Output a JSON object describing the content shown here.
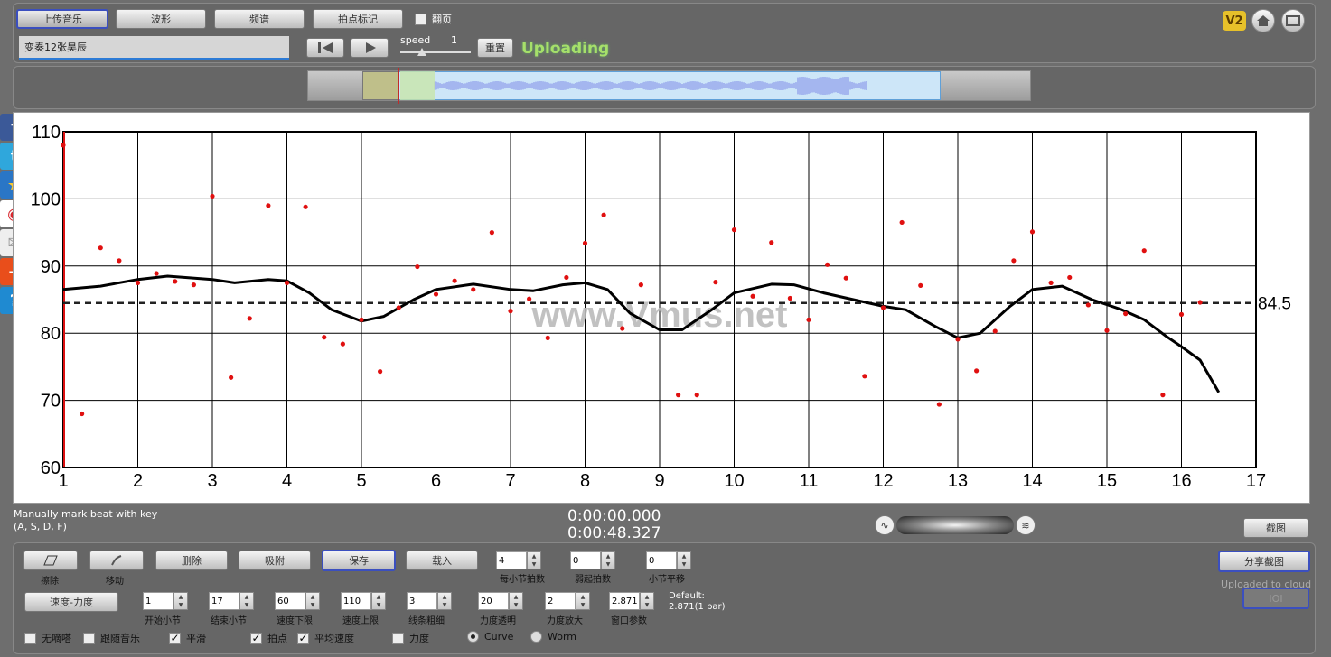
{
  "toolbar": {
    "upload_label": "上传音乐",
    "waveform_label": "波形",
    "spectrum_label": "频谱",
    "beat_mark_label": "拍点标记",
    "page_flip_label": "翻页",
    "page_flip_checked": false
  },
  "track": {
    "name": "变奏12张昊辰"
  },
  "player": {
    "speed_label": "speed",
    "speed_value": "1",
    "reset_label": "重置",
    "status": "Uploading"
  },
  "top_icons": {
    "v2_label": "V2",
    "home_icon": "home-icon",
    "screen_icon": "screen-icon"
  },
  "social": [
    {
      "name": "facebook-icon",
      "glyph": "f",
      "color": "#3b5998"
    },
    {
      "name": "twitter-icon",
      "glyph": "t",
      "color": "#2fa7dc"
    },
    {
      "name": "star-icon",
      "glyph": "★",
      "color": "#2a76c6"
    },
    {
      "name": "weibo-icon",
      "glyph": "◉",
      "color": "#d8272d"
    },
    {
      "name": "mail-icon",
      "glyph": "✉",
      "color": "#e6e6e6"
    },
    {
      "name": "add-icon",
      "glyph": "+",
      "color": "#e94e1b"
    },
    {
      "name": "help-icon",
      "glyph": "?",
      "color": "#1f8ad1"
    }
  ],
  "watermark": "www.Vmus.net",
  "chart_data": {
    "type": "scatter",
    "xlim": [
      1,
      17
    ],
    "ylim": [
      60,
      110
    ],
    "x_ticks": [
      "1",
      "2",
      "3",
      "4",
      "5",
      "6",
      "7",
      "8",
      "9",
      "10",
      "11",
      "12",
      "13",
      "14",
      "15",
      "16",
      "17"
    ],
    "y_ticks": [
      "60",
      "70",
      "80",
      "90",
      "100",
      "110"
    ],
    "grid": true,
    "average": 84.5,
    "average_label": "84.5",
    "points": [
      [
        1.0,
        108
      ],
      [
        1.25,
        68
      ],
      [
        1.5,
        92.7
      ],
      [
        1.75,
        90.8
      ],
      [
        2.0,
        87.5
      ],
      [
        2.25,
        88.9
      ],
      [
        2.5,
        87.7
      ],
      [
        2.75,
        87.2
      ],
      [
        3.0,
        100.4
      ],
      [
        3.25,
        73.4
      ],
      [
        3.5,
        82.2
      ],
      [
        3.75,
        99
      ],
      [
        4.0,
        87.5
      ],
      [
        4.25,
        98.8
      ],
      [
        4.5,
        79.4
      ],
      [
        4.75,
        78.4
      ],
      [
        5.0,
        82
      ],
      [
        5.25,
        74.3
      ],
      [
        5.5,
        83.8
      ],
      [
        5.75,
        89.9
      ],
      [
        6.0,
        85.8
      ],
      [
        6.25,
        87.8
      ],
      [
        6.5,
        86.5
      ],
      [
        6.75,
        95
      ],
      [
        7.0,
        83.3
      ],
      [
        7.25,
        85.1
      ],
      [
        7.5,
        79.3
      ],
      [
        7.75,
        88.3
      ],
      [
        8.0,
        93.4
      ],
      [
        8.25,
        97.6
      ],
      [
        8.5,
        80.7
      ],
      [
        8.75,
        87.2
      ],
      [
        9.25,
        70.8
      ],
      [
        9.5,
        70.8
      ],
      [
        9.75,
        87.6
      ],
      [
        10.0,
        95.4
      ],
      [
        10.25,
        85.5
      ],
      [
        10.5,
        93.5
      ],
      [
        10.75,
        85.2
      ],
      [
        11.0,
        82
      ],
      [
        11.25,
        90.2
      ],
      [
        11.5,
        88.2
      ],
      [
        11.75,
        73.6
      ],
      [
        12.0,
        83.8
      ],
      [
        12.25,
        96.5
      ],
      [
        12.5,
        87.1
      ],
      [
        12.75,
        69.4
      ],
      [
        13.0,
        79.1
      ],
      [
        13.25,
        74.4
      ],
      [
        13.5,
        80.3
      ],
      [
        13.75,
        90.8
      ],
      [
        14.0,
        95.1
      ],
      [
        14.25,
        87.5
      ],
      [
        14.5,
        88.3
      ],
      [
        14.75,
        84.2
      ],
      [
        15.0,
        80.4
      ],
      [
        15.25,
        82.9
      ],
      [
        15.5,
        92.3
      ],
      [
        15.75,
        70.8
      ],
      [
        16.0,
        82.8
      ],
      [
        16.25,
        84.6
      ]
    ],
    "curve": [
      [
        1.0,
        86.5
      ],
      [
        1.5,
        87.0
      ],
      [
        2.0,
        88.0
      ],
      [
        2.4,
        88.5
      ],
      [
        3.0,
        88.0
      ],
      [
        3.3,
        87.5
      ],
      [
        3.75,
        88.0
      ],
      [
        4.0,
        87.8
      ],
      [
        4.3,
        86.0
      ],
      [
        4.6,
        83.5
      ],
      [
        5.0,
        81.8
      ],
      [
        5.3,
        82.5
      ],
      [
        5.7,
        85.0
      ],
      [
        6.0,
        86.5
      ],
      [
        6.5,
        87.3
      ],
      [
        7.0,
        86.5
      ],
      [
        7.3,
        86.3
      ],
      [
        7.7,
        87.2
      ],
      [
        8.0,
        87.5
      ],
      [
        8.3,
        86.5
      ],
      [
        8.6,
        83.0
      ],
      [
        9.0,
        80.5
      ],
      [
        9.3,
        80.5
      ],
      [
        9.7,
        83.5
      ],
      [
        10.0,
        86.0
      ],
      [
        10.5,
        87.3
      ],
      [
        10.8,
        87.2
      ],
      [
        11.2,
        86.0
      ],
      [
        11.6,
        85.0
      ],
      [
        12.0,
        84.0
      ],
      [
        12.3,
        83.5
      ],
      [
        12.7,
        81.0
      ],
      [
        13.0,
        79.3
      ],
      [
        13.3,
        80.0
      ],
      [
        13.7,
        84.0
      ],
      [
        14.0,
        86.5
      ],
      [
        14.4,
        87.0
      ],
      [
        14.8,
        85.0
      ],
      [
        15.2,
        83.5
      ],
      [
        15.5,
        82.0
      ],
      [
        15.8,
        79.5
      ],
      [
        16.0,
        78.0
      ],
      [
        16.25,
        76.0
      ],
      [
        16.5,
        71.2
      ]
    ]
  },
  "hint": {
    "line1": "Manually mark beat with key",
    "line2": "(A, S, D, F)"
  },
  "time": {
    "current": "0:00:00.000",
    "total": "0:00:48.327"
  },
  "capture_label": "截图",
  "tools": {
    "eraser_label": "擦除",
    "move_label": "移动",
    "delete_label": "删除",
    "snap_label": "吸附",
    "save_label": "保存",
    "load_label": "载入"
  },
  "row1_steppers": [
    {
      "value": "4",
      "label": "每小节拍数"
    },
    {
      "value": "0",
      "label": "弱起拍数"
    },
    {
      "value": "0",
      "label": "小节平移"
    }
  ],
  "mode_label": "速度-力度",
  "row2_steppers": [
    {
      "value": "1",
      "label": "开始小节"
    },
    {
      "value": "17",
      "label": "结束小节"
    },
    {
      "value": "60",
      "label": "速度下限"
    },
    {
      "value": "110",
      "label": "速度上限"
    },
    {
      "value": "3",
      "label": "线条粗细"
    },
    {
      "value": "20",
      "label": "力度透明"
    },
    {
      "value": "2",
      "label": "力度放大"
    },
    {
      "value": "2.871",
      "label": "窗口参数"
    }
  ],
  "default_note": {
    "line1": "Default:",
    "line2": "2.871(1 bar)"
  },
  "options": [
    {
      "label": "无嘀嗒",
      "checked": false
    },
    {
      "label": "跟随音乐",
      "checked": false
    },
    {
      "label": "平滑",
      "checked": true
    },
    {
      "label": "拍点",
      "checked": true
    },
    {
      "label": "平均速度",
      "checked": true
    },
    {
      "label": "力度",
      "checked": false
    }
  ],
  "display": [
    {
      "label": "Curve",
      "selected": true
    },
    {
      "label": "Worm",
      "selected": false
    }
  ],
  "share": {
    "label": "分享截图",
    "status": "Uploaded to cloud",
    "ioi_label": "IOI"
  }
}
